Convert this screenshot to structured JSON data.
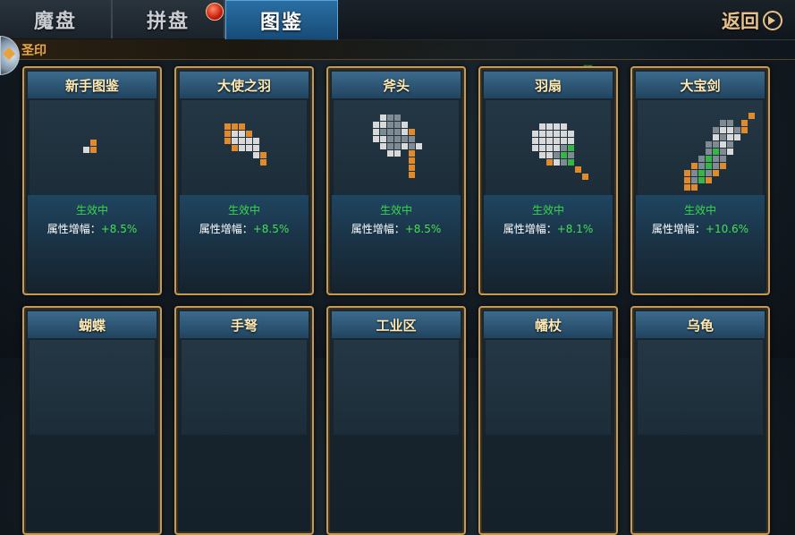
{
  "tabs": [
    {
      "label": "魔盘"
    },
    {
      "label": "拼盘"
    },
    {
      "label": "图鉴"
    }
  ],
  "active_tab": 2,
  "back_button": {
    "label": "返回"
  },
  "section": {
    "title": "圣印"
  },
  "corner_mark": "蠶",
  "colors": {
    "orange": "#e08a2c",
    "white": "#d9d9d9",
    "gray": "#7f8a93",
    "green": "#36b646",
    "active_text": "#44e052"
  },
  "cards": [
    {
      "name": "新手图鉴",
      "status": "生效中",
      "bonus_label": "属性增幅：",
      "bonus_value": "+8.5%"
    },
    {
      "name": "大使之羽",
      "status": "生效中",
      "bonus_label": "属性增幅：",
      "bonus_value": "+8.5%"
    },
    {
      "name": "斧头",
      "status": "生效中",
      "bonus_label": "属性增幅：",
      "bonus_value": "+8.5%"
    },
    {
      "name": "羽扇",
      "status": "生效中",
      "bonus_label": "属性增幅：",
      "bonus_value": "+8.1%"
    },
    {
      "name": "大宝剑",
      "status": "生效中",
      "bonus_label": "属性增幅：",
      "bonus_value": "+10.6%"
    }
  ],
  "cards_row2": [
    {
      "name": "蝴蝶"
    },
    {
      "name": "手弩"
    },
    {
      "name": "工业区"
    },
    {
      "name": "幡杖"
    },
    {
      "name": "乌龟"
    }
  ]
}
